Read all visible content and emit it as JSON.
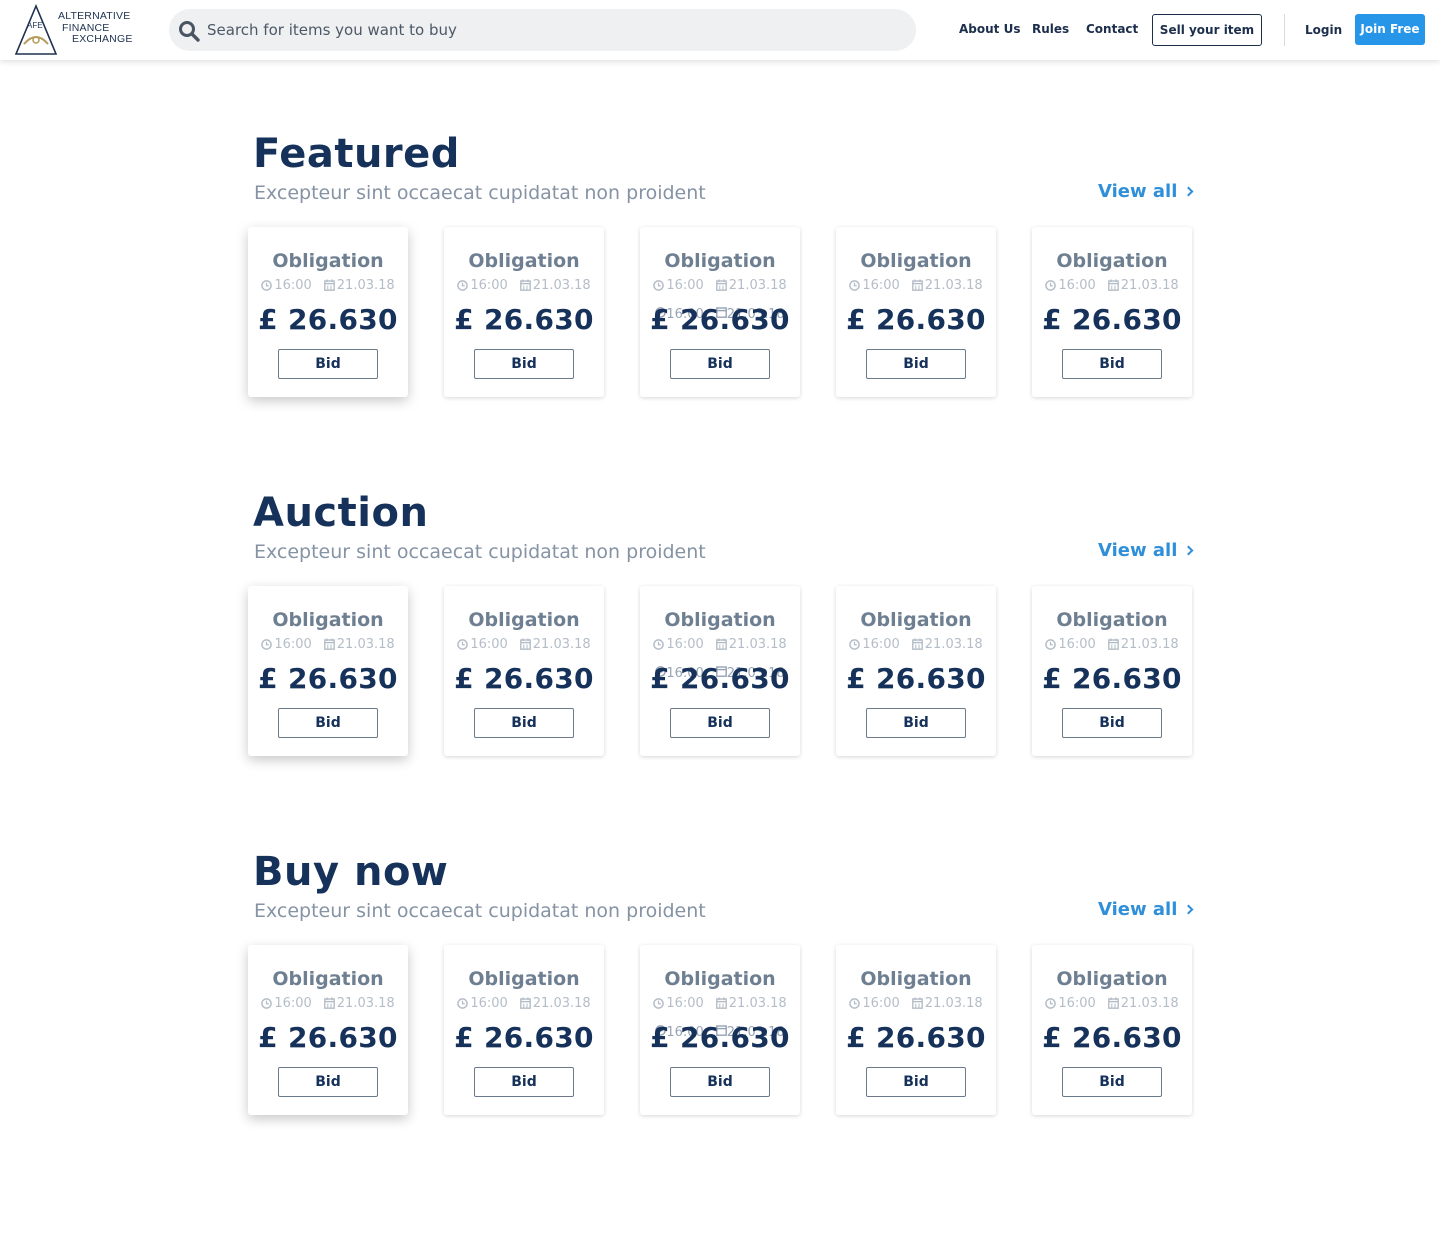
{
  "brand": {
    "logo_lines": [
      "ALTERNATIVE",
      "FINANCE",
      "EXCHANGE"
    ],
    "logo_mark": "AFE",
    "accent_blue": "#2795e8",
    "navy": "#16325a"
  },
  "search": {
    "placeholder": "Search for items you want to buy",
    "value": ""
  },
  "nav": {
    "about": "About Us",
    "rules": "Rules",
    "contact": "Contact",
    "sell": "Sell your item",
    "login": "Login",
    "join": "Join Free"
  },
  "sections": [
    {
      "title": "Featured",
      "subtitle": "Excepteur sint occaecat cupidatat non proident",
      "view_all": "View all"
    },
    {
      "title": "Auction",
      "subtitle": "Excepteur sint occaecat cupidatat non proident",
      "view_all": "View all"
    },
    {
      "title": "Buy now",
      "subtitle": "Excepteur sint occaecat cupidatat non proident",
      "view_all": "View all"
    }
  ],
  "card": {
    "title": "Obligation",
    "time": "16:00",
    "date": "21.03.18",
    "price": "£ 26.630",
    "bid_label": "Bid"
  },
  "icons": [
    "search-icon",
    "clock-icon",
    "calendar-icon",
    "chevron-right-icon"
  ]
}
